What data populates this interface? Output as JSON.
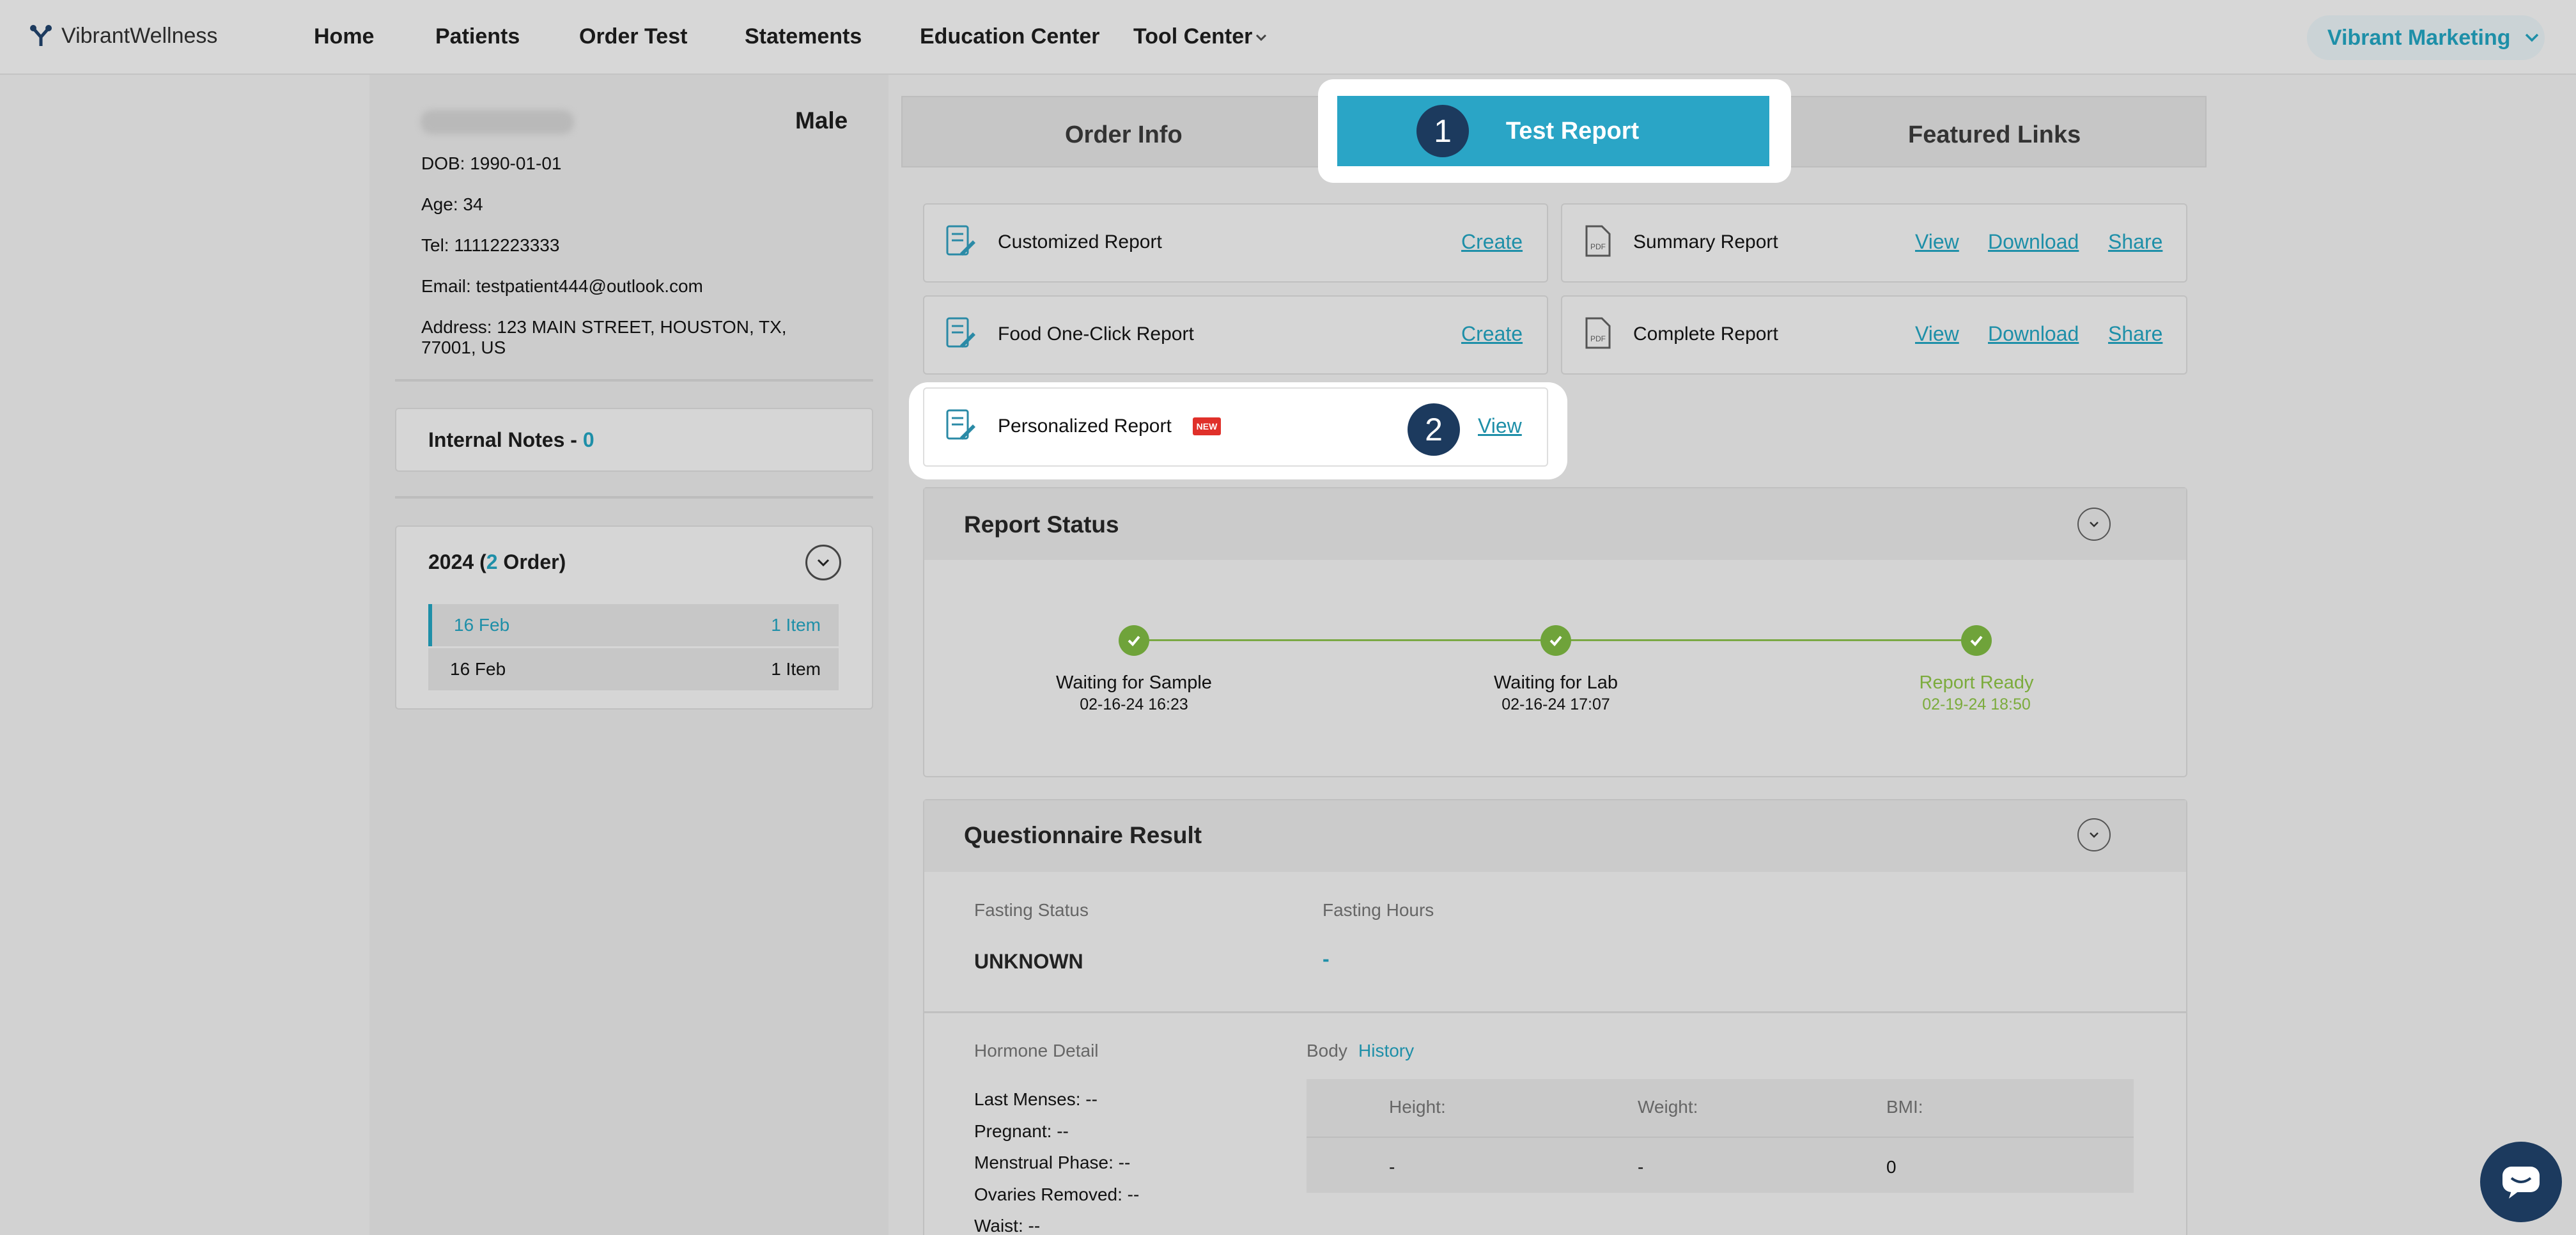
{
  "header": {
    "brand": "VibrantWellness",
    "nav": [
      "Home",
      "Patients",
      "Order Test",
      "Statements",
      "Education Center",
      "Tool Center"
    ],
    "account": "Vibrant Marketing"
  },
  "patient": {
    "gender": "Male",
    "dob": "DOB: 1990-01-01",
    "age": "Age: 34",
    "tel": "Tel: 11112223333",
    "email": "Email: testpatient444@outlook.com",
    "address_line1": "Address: 123 MAIN STREET, HOUSTON, TX,",
    "address_line2": "77001, US"
  },
  "notes": {
    "label": "Internal Notes - ",
    "count": "0"
  },
  "orders": {
    "year_prefix": "2024 (",
    "count": "2",
    "suffix": " Order)",
    "items": [
      {
        "date": "16 Feb",
        "items": "1 Item"
      },
      {
        "date": "16 Feb",
        "items": "1 Item"
      }
    ]
  },
  "tabs": {
    "order_info": "Order Info",
    "test_report": "Test Report",
    "featured_links": "Featured Links"
  },
  "steps": {
    "one": "1",
    "two": "2"
  },
  "reports": {
    "customized": {
      "label": "Customized Report",
      "create": "Create"
    },
    "summary": {
      "label": "Summary Report",
      "view": "View",
      "download": "Download",
      "share": "Share"
    },
    "food": {
      "label": "Food One-Click Report",
      "create": "Create"
    },
    "complete": {
      "label": "Complete Report",
      "view": "View",
      "download": "Download",
      "share": "Share"
    },
    "personalized": {
      "label": "Personalized Report",
      "badge": "NEW",
      "view": "View"
    }
  },
  "report_status": {
    "title": "Report Status",
    "steps": [
      {
        "label": "Waiting for Sample",
        "time": "02-16-24 16:23"
      },
      {
        "label": "Waiting for Lab",
        "time": "02-16-24 17:07"
      },
      {
        "label": "Report Ready",
        "time": "02-19-24 18:50"
      }
    ],
    "ready_color": "#7bab3c"
  },
  "questionnaire": {
    "title": "Questionnaire Result",
    "fasting_status_label": "Fasting Status",
    "fasting_status_value": "UNKNOWN",
    "fasting_hours_label": "Fasting Hours",
    "fasting_hours_value": "-",
    "hormone_label": "Hormone Detail",
    "last_menses": "Last Menses: --",
    "pregnant": "Pregnant: --",
    "menstrual_phase": "Menstrual Phase: --",
    "ovaries_removed": "Ovaries Removed: --",
    "waist": "Waist: --",
    "body_label": "Body",
    "history_label": "History",
    "height_label": "Height:",
    "weight_label": "Weight:",
    "bmi_label": "BMI:",
    "height_value": "-",
    "weight_value": "-",
    "bmi_value": "0"
  },
  "colors": {
    "accent": "#2aa5c6",
    "link": "#1e8fa8",
    "step_badge": "#1c3a5e",
    "new_badge": "#e0302a"
  }
}
